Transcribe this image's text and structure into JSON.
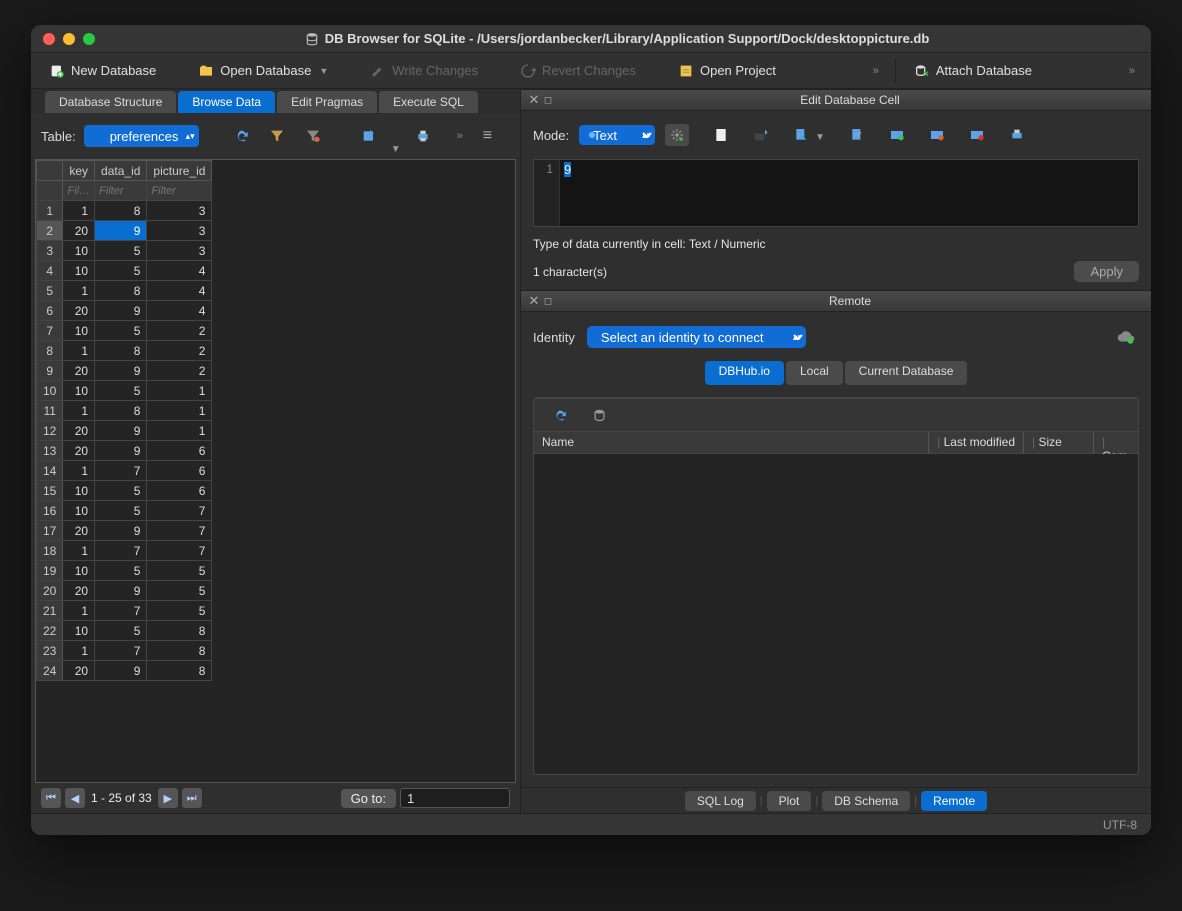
{
  "window": {
    "title": "DB Browser for SQLite - /Users/jordanbecker/Library/Application Support/Dock/desktoppicture.db"
  },
  "toolbar": {
    "new_db": "New Database",
    "open_db": "Open Database",
    "write_changes": "Write Changes",
    "revert_changes": "Revert Changes",
    "open_project": "Open Project",
    "attach_db": "Attach Database"
  },
  "main_tabs": {
    "structure": "Database Structure",
    "browse": "Browse Data",
    "pragmas": "Edit Pragmas",
    "sql": "Execute SQL"
  },
  "browse": {
    "table_label": "Table:",
    "current_table": "preferences",
    "columns": [
      "key",
      "data_id",
      "picture_id"
    ],
    "filter_placeholder_short": "Fil…",
    "filter_placeholder": "Filter",
    "rows": [
      [
        1,
        8,
        3
      ],
      [
        20,
        9,
        3
      ],
      [
        10,
        5,
        3
      ],
      [
        10,
        5,
        4
      ],
      [
        1,
        8,
        4
      ],
      [
        20,
        9,
        4
      ],
      [
        10,
        5,
        2
      ],
      [
        1,
        8,
        2
      ],
      [
        20,
        9,
        2
      ],
      [
        10,
        5,
        1
      ],
      [
        1,
        8,
        1
      ],
      [
        20,
        9,
        1
      ],
      [
        20,
        9,
        6
      ],
      [
        1,
        7,
        6
      ],
      [
        10,
        5,
        6
      ],
      [
        10,
        5,
        7
      ],
      [
        20,
        9,
        7
      ],
      [
        1,
        7,
        7
      ],
      [
        10,
        5,
        5
      ],
      [
        20,
        9,
        5
      ],
      [
        1,
        7,
        5
      ],
      [
        10,
        5,
        8
      ],
      [
        1,
        7,
        8
      ],
      [
        20,
        9,
        8
      ]
    ],
    "selected_row_index": 1,
    "selected_col_index": 1,
    "paginator": {
      "range": "1 - 25 of 33",
      "goto_label": "Go to:",
      "goto_value": "1"
    }
  },
  "edit_cell": {
    "panel_title": "Edit Database Cell",
    "mode_label": "Mode:",
    "mode_value": "Text",
    "line_number": "1",
    "cell_value": "9",
    "data_type_info": "Type of data currently in cell: Text / Numeric",
    "char_count": "1 character(s)",
    "apply": "Apply"
  },
  "remote": {
    "panel_title": "Remote",
    "identity_label": "Identity",
    "identity_value": "Select an identity to connect",
    "tabs": {
      "dbhub": "DBHub.io",
      "local": "Local",
      "current": "Current Database"
    },
    "columns": {
      "name": "Name",
      "modified": "Last modified",
      "size": "Size",
      "com": "Com"
    }
  },
  "bottom_tabs": {
    "sql_log": "SQL Log",
    "plot": "Plot",
    "db_schema": "DB Schema",
    "remote": "Remote"
  },
  "status": {
    "encoding": "UTF-8"
  }
}
